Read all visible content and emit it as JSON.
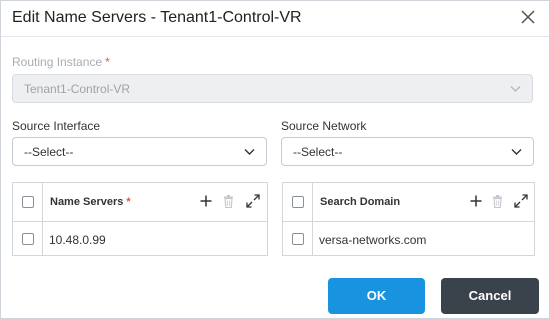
{
  "dialog": {
    "title": "Edit Name Servers - Tenant1-Control-VR"
  },
  "routing_instance": {
    "label": "Routing Instance",
    "required_mark": "*",
    "value": "Tenant1-Control-VR"
  },
  "source_interface": {
    "label": "Source Interface",
    "value": "--Select--"
  },
  "source_network": {
    "label": "Source Network",
    "value": "--Select--"
  },
  "name_servers_grid": {
    "header": "Name Servers",
    "required_mark": "*",
    "rows": [
      "10.48.0.99"
    ]
  },
  "search_domain_grid": {
    "header": "Search Domain",
    "rows": [
      "versa-networks.com"
    ]
  },
  "buttons": {
    "ok": "OK",
    "cancel": "Cancel"
  },
  "colors": {
    "primary": "#1793e0",
    "secondary": "#3a434c",
    "required": "#e05353"
  },
  "icons": [
    "close-icon",
    "chevron-down-icon",
    "plus-icon",
    "trash-icon",
    "expand-icon"
  ]
}
